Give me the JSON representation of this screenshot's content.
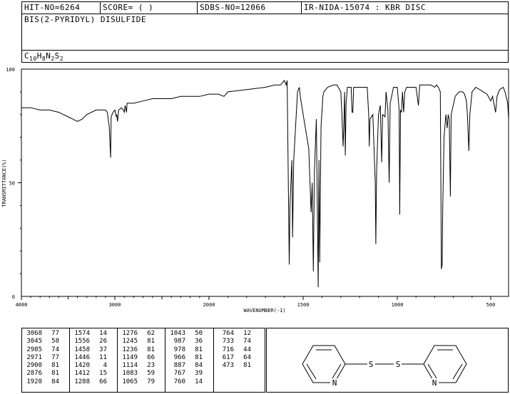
{
  "header": {
    "hit_no": "HIT-NO=6264",
    "score": "SCORE=  (   )",
    "sdbs_no": "SDBS-NO=12066",
    "ir_info": "IR-NIDA-15074 : KBR DISC",
    "compound_name": "BIS(2-PYRIDYL) DISULFIDE",
    "formula": {
      "c": "C",
      "c_n": "10",
      "h": "H",
      "h_n": "8",
      "n": "N",
      "n_n": "2",
      "s": "S",
      "s_n": "2"
    }
  },
  "chart_data": {
    "type": "line",
    "xlabel": "WAVENUMBER(-1)",
    "ylabel": "TRANSMITTANCE(%)",
    "xlim": [
      4000,
      400
    ],
    "ylim": [
      0,
      100
    ],
    "x_ticks": [
      4000,
      3000,
      2000,
      1500,
      1000,
      500
    ],
    "y_ticks": [
      0,
      50,
      100
    ],
    "x_tick_labels": [
      "4000",
      "3000",
      "2000",
      "1500",
      "1000",
      "500"
    ],
    "y_tick_labels": [
      "0",
      "50",
      "100"
    ],
    "series": [
      {
        "points": [
          [
            4000,
            83
          ],
          [
            3900,
            83
          ],
          [
            3800,
            82
          ],
          [
            3700,
            82
          ],
          [
            3600,
            81
          ],
          [
            3500,
            79
          ],
          [
            3450,
            78
          ],
          [
            3400,
            77
          ],
          [
            3350,
            78
          ],
          [
            3300,
            80
          ],
          [
            3200,
            82
          ],
          [
            3100,
            82
          ],
          [
            3080,
            81
          ],
          [
            3068,
            77
          ],
          [
            3060,
            75
          ],
          [
            3045,
            61
          ],
          [
            3040,
            79
          ],
          [
            3020,
            81
          ],
          [
            3000,
            82
          ],
          [
            2985,
            79
          ],
          [
            2980,
            80
          ],
          [
            2971,
            77
          ],
          [
            2960,
            82
          ],
          [
            2930,
            83
          ],
          [
            2910,
            82
          ],
          [
            2900,
            81
          ],
          [
            2890,
            84
          ],
          [
            2876,
            81
          ],
          [
            2870,
            85
          ],
          [
            2800,
            85
          ],
          [
            2700,
            86
          ],
          [
            2600,
            87
          ],
          [
            2500,
            87
          ],
          [
            2400,
            87
          ],
          [
            2300,
            88
          ],
          [
            2200,
            88
          ],
          [
            2100,
            88
          ],
          [
            2000,
            89
          ],
          [
            1950,
            89
          ],
          [
            1920,
            88
          ],
          [
            1900,
            90
          ],
          [
            1800,
            91
          ],
          [
            1700,
            92
          ],
          [
            1650,
            93
          ],
          [
            1620,
            93
          ],
          [
            1600,
            95
          ],
          [
            1590,
            93
          ],
          [
            1585,
            95
          ],
          [
            1574,
            14
          ],
          [
            1570,
            40
          ],
          [
            1560,
            60
          ],
          [
            1556,
            26
          ],
          [
            1550,
            60
          ],
          [
            1530,
            90
          ],
          [
            1520,
            92
          ],
          [
            1515,
            88
          ],
          [
            1500,
            80
          ],
          [
            1470,
            65
          ],
          [
            1458,
            37
          ],
          [
            1452,
            50
          ],
          [
            1446,
            11
          ],
          [
            1440,
            55
          ],
          [
            1430,
            78
          ],
          [
            1420,
            4
          ],
          [
            1416,
            60
          ],
          [
            1412,
            15
          ],
          [
            1405,
            75
          ],
          [
            1395,
            88
          ],
          [
            1390,
            90
          ],
          [
            1370,
            92
          ],
          [
            1340,
            93
          ],
          [
            1320,
            93
          ],
          [
            1300,
            90
          ],
          [
            1295,
            82
          ],
          [
            1288,
            66
          ],
          [
            1284,
            75
          ],
          [
            1280,
            90
          ],
          [
            1276,
            62
          ],
          [
            1272,
            85
          ],
          [
            1265,
            92
          ],
          [
            1245,
            92
          ],
          [
            1240,
            81
          ],
          [
            1236,
            81
          ],
          [
            1232,
            92
          ],
          [
            1200,
            92
          ],
          [
            1160,
            92
          ],
          [
            1152,
            80
          ],
          [
            1149,
            66
          ],
          [
            1145,
            78
          ],
          [
            1130,
            80
          ],
          [
            1117,
            50
          ],
          [
            1114,
            23
          ],
          [
            1110,
            55
          ],
          [
            1100,
            80
          ],
          [
            1090,
            84
          ],
          [
            1083,
            59
          ],
          [
            1078,
            80
          ],
          [
            1065,
            79
          ],
          [
            1060,
            90
          ],
          [
            1050,
            82
          ],
          [
            1043,
            50
          ],
          [
            1038,
            85
          ],
          [
            1020,
            92
          ],
          [
            1000,
            92
          ],
          [
            990,
            82
          ],
          [
            987,
            36
          ],
          [
            983,
            82
          ],
          [
            978,
            81
          ],
          [
            972,
            90
          ],
          [
            966,
            81
          ],
          [
            960,
            90
          ],
          [
            950,
            92
          ],
          [
            900,
            92
          ],
          [
            887,
            84
          ],
          [
            880,
            93
          ],
          [
            820,
            93
          ],
          [
            800,
            92
          ],
          [
            790,
            93
          ],
          [
            780,
            92
          ],
          [
            770,
            90
          ],
          [
            764,
            12
          ],
          [
            760,
            14
          ],
          [
            757,
            39
          ],
          [
            750,
            70
          ],
          [
            740,
            80
          ],
          [
            733,
            74
          ],
          [
            728,
            80
          ],
          [
            722,
            78
          ],
          [
            716,
            44
          ],
          [
            712,
            80
          ],
          [
            690,
            88
          ],
          [
            670,
            90
          ],
          [
            650,
            90
          ],
          [
            640,
            89
          ],
          [
            630,
            86
          ],
          [
            625,
            80
          ],
          [
            617,
            64
          ],
          [
            612,
            80
          ],
          [
            600,
            90
          ],
          [
            580,
            92
          ],
          [
            560,
            91
          ],
          [
            540,
            90
          ],
          [
            520,
            89
          ],
          [
            500,
            86
          ],
          [
            490,
            88
          ],
          [
            473,
            81
          ],
          [
            465,
            88
          ],
          [
            450,
            91
          ],
          [
            430,
            92
          ],
          [
            420,
            90
          ],
          [
            405,
            85
          ],
          [
            400,
            78
          ]
        ]
      }
    ]
  },
  "peak_table": {
    "columns": [
      [
        [
          "3068",
          "77"
        ],
        [
          "3045",
          "58"
        ],
        [
          "2985",
          "74"
        ],
        [
          "2971",
          "77"
        ],
        [
          "2900",
          "81"
        ],
        [
          "2876",
          "81"
        ],
        [
          "1920",
          "84"
        ]
      ],
      [
        [
          "1574",
          "14"
        ],
        [
          "1556",
          "26"
        ],
        [
          "1458",
          "37"
        ],
        [
          "1446",
          "11"
        ],
        [
          "1420",
          "4"
        ],
        [
          "1412",
          "15"
        ],
        [
          "1288",
          "66"
        ]
      ],
      [
        [
          "1276",
          "62"
        ],
        [
          "1245",
          "81"
        ],
        [
          "1236",
          "81"
        ],
        [
          "1149",
          "66"
        ],
        [
          "1114",
          "23"
        ],
        [
          "1083",
          "59"
        ],
        [
          "1065",
          "79"
        ]
      ],
      [
        [
          "1043",
          "50"
        ],
        [
          "987",
          "36"
        ],
        [
          "978",
          "81"
        ],
        [
          "966",
          "81"
        ],
        [
          "887",
          "84"
        ],
        [
          "767",
          "39"
        ],
        [
          "760",
          "14"
        ]
      ],
      [
        [
          "764",
          "12"
        ],
        [
          "733",
          "74"
        ],
        [
          "716",
          "44"
        ],
        [
          "617",
          "64"
        ],
        [
          "473",
          "81"
        ]
      ]
    ]
  },
  "structure": {
    "atom_n1": "N",
    "atom_n2": "N",
    "atom_s1": "S",
    "atom_s2": "S"
  }
}
